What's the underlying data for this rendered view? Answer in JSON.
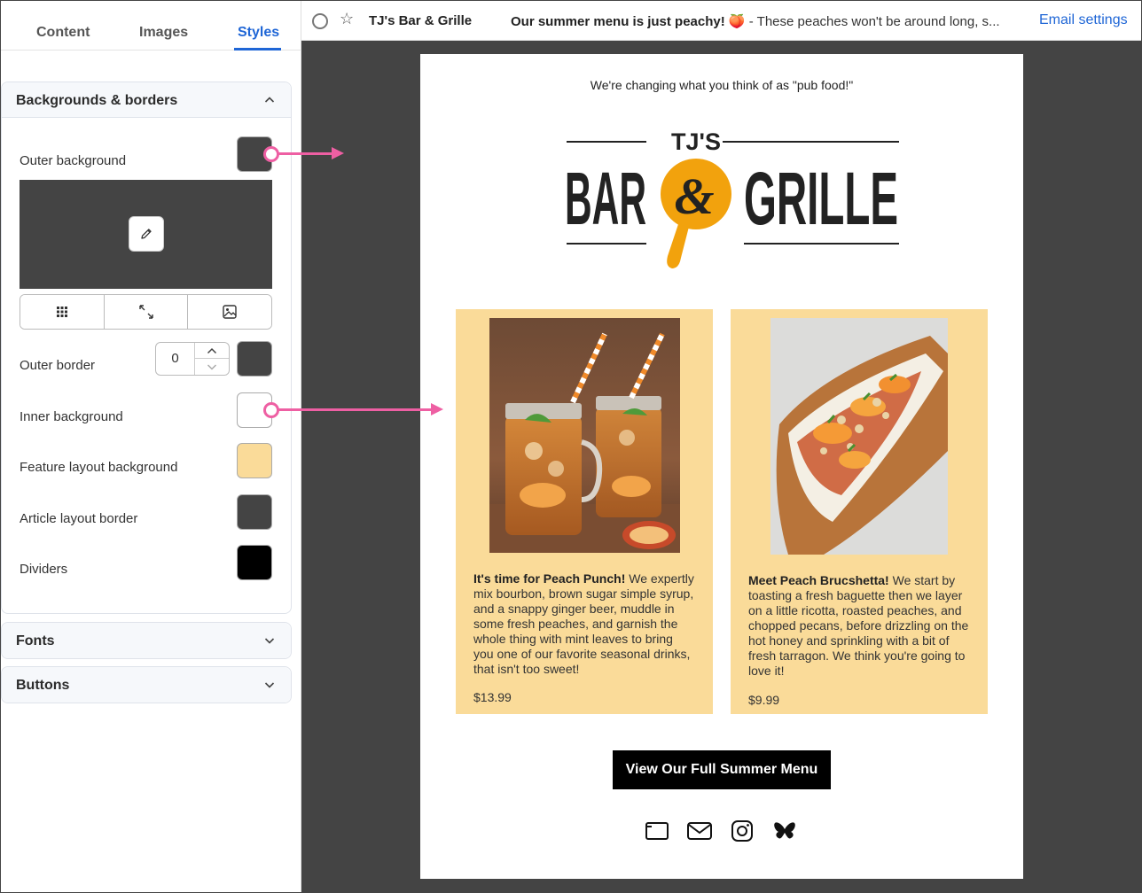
{
  "tabs": [
    {
      "label": "Content"
    },
    {
      "label": "Images"
    },
    {
      "label": "Styles"
    }
  ],
  "sections": {
    "backgrounds": {
      "title": "Backgrounds & borders",
      "outer_background": {
        "label": "Outer background",
        "color": "#444444"
      },
      "outer_border": {
        "label": "Outer border",
        "value": "0",
        "color": "#444444"
      },
      "inner_background": {
        "label": "Inner background",
        "color": "#ffffff"
      },
      "feature_layout_background": {
        "label": "Feature layout background",
        "color": "#fadb99"
      },
      "article_layout_border": {
        "label": "Article layout border",
        "color": "#444444"
      },
      "dividers": {
        "label": "Dividers",
        "color": "#000000"
      }
    },
    "fonts": {
      "title": "Fonts"
    },
    "buttons": {
      "title": "Buttons"
    }
  },
  "email_header": {
    "sender": "TJ's Bar & Grille",
    "subject_bold": "Our summer menu is just peachy! 🍑",
    "subject_preview": " - These peaches won't be around long, s...",
    "settings_link": "Email settings"
  },
  "email": {
    "preheader": "We're changing what you think of as \"pub food!\"",
    "logo": {
      "top": "TJ'S",
      "left": "BAR",
      "amp": "&",
      "right": "GRILLE"
    },
    "cards": [
      {
        "lines": [
          {
            "bold": "It's time for Peach Punch!",
            "text": " We expertly"
          },
          {
            "text": "mix bourbon, brown sugar simple syrup,"
          },
          {
            "text": "and a snappy ginger beer, muddle in"
          },
          {
            "text": "some fresh peaches, and garnish the"
          },
          {
            "text": "whole thing with mint leaves to bring"
          },
          {
            "text": "you one of our favorite seasonal drinks,"
          },
          {
            "text": "that isn't too sweet!"
          }
        ],
        "price": "$13.99"
      },
      {
        "lines": [
          {
            "bold": "Meet Peach Brucshetta!",
            "text": " We start by"
          },
          {
            "text": "toasting a fresh baguette then we layer"
          },
          {
            "text": "on a little ricotta, roasted peaches, and"
          },
          {
            "text": "chopped pecans, before drizzling on the"
          },
          {
            "text": "hot honey and sprinkling with a bit of"
          },
          {
            "text": "fresh tarragon. We think you're going to"
          },
          {
            "text": "love it!"
          }
        ],
        "price": "$9.99"
      }
    ],
    "cta": "View Our Full Summer Menu",
    "social_icons": [
      "website-icon",
      "email-icon",
      "instagram-icon",
      "bluesky-icon"
    ]
  },
  "colors": {
    "accent": "#1f66d6",
    "callout": "#ee5fa3",
    "logo_orange": "#f2a20d"
  }
}
